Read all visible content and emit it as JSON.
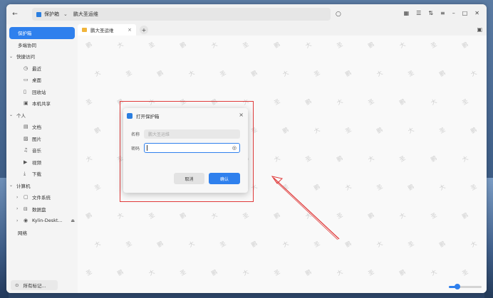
{
  "titlebar": {
    "back_icon": "back-arrow-icon",
    "path": [
      "保护箱",
      "鹏大圣运维"
    ]
  },
  "sidebar": {
    "items": [
      {
        "label": "保护箱",
        "kind": "active"
      },
      {
        "label": "多端协同",
        "kind": "plain"
      },
      {
        "label": "快捷访问",
        "kind": "group"
      },
      {
        "label": "最近",
        "kind": "child",
        "icon": "clock-icon"
      },
      {
        "label": "桌面",
        "kind": "child",
        "icon": "desktop-icon"
      },
      {
        "label": "回收站",
        "kind": "child",
        "icon": "trash-icon"
      },
      {
        "label": "本机共享",
        "kind": "child",
        "icon": "share-icon"
      },
      {
        "label": "个人",
        "kind": "group"
      },
      {
        "label": "文档",
        "kind": "child",
        "icon": "document-icon"
      },
      {
        "label": "图片",
        "kind": "child",
        "icon": "picture-icon"
      },
      {
        "label": "音乐",
        "kind": "child",
        "icon": "music-icon"
      },
      {
        "label": "视频",
        "kind": "child",
        "icon": "video-icon"
      },
      {
        "label": "下载",
        "kind": "child",
        "icon": "download-icon"
      },
      {
        "label": "计算机",
        "kind": "group"
      },
      {
        "label": "文件系统",
        "kind": "device",
        "icon": "filesystem-icon"
      },
      {
        "label": "数据盘",
        "kind": "device",
        "icon": "disk-icon"
      },
      {
        "label": "Kylin-Deskt...",
        "kind": "device",
        "icon": "disc-icon"
      },
      {
        "label": "网络",
        "kind": "plain"
      }
    ],
    "footer_label": "所有标记..."
  },
  "tabs": [
    {
      "label": "鹏大圣运维"
    }
  ],
  "watermark": [
    "鹏",
    "大",
    "圣"
  ],
  "dialog": {
    "title": "打开保护箱",
    "name_label": "名称",
    "name_value": "鹏大圣运维",
    "password_label": "密码",
    "password_value": "",
    "cancel_label": "取消",
    "ok_label": "确认"
  },
  "zoom_level": 0.25,
  "colors": {
    "accent": "#2f80ed",
    "highlight": "#e03a3a"
  }
}
